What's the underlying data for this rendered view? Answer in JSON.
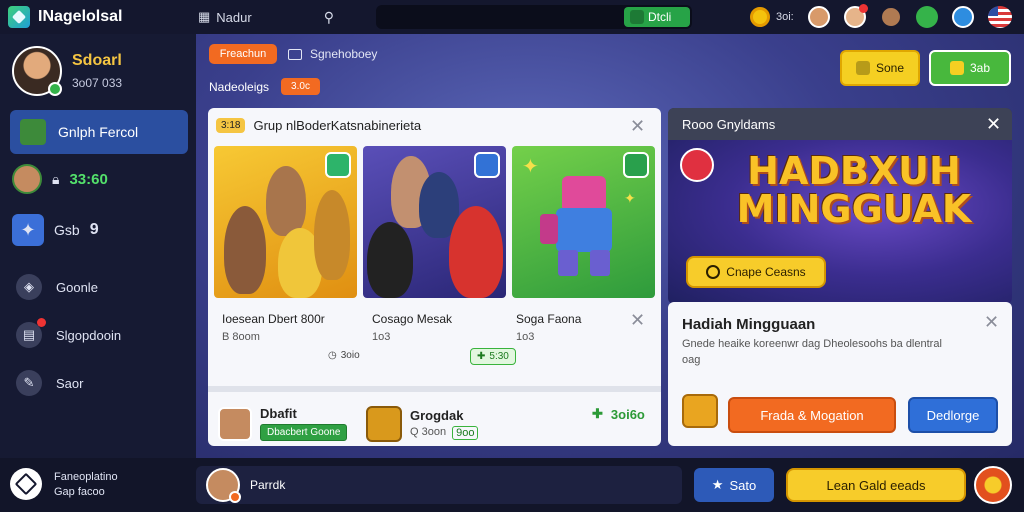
{
  "topbar": {
    "app_title": "INagelolsal",
    "search_label": "Nadur",
    "progress_label": "Dtcli",
    "coins": "3oi:"
  },
  "sidebar": {
    "profile_name": "Sdoarl",
    "profile_id": "3o07 033",
    "active_item": "Gnlph Fercol",
    "stat_value": "33:60",
    "level_label": "Gsb",
    "level_value": "9",
    "nav": [
      {
        "label": "Goonle",
        "icon": "gamepad-icon"
      },
      {
        "label": "Slgopdooin",
        "icon": "store-icon"
      },
      {
        "label": "Saor",
        "icon": "settings-icon"
      }
    ]
  },
  "main": {
    "orange_chip": "Freachun",
    "sub_chip": "Sgnehoboey",
    "section_label": "Nadeoleigs",
    "section_price": "3.0c",
    "yellow_btn": "Sone",
    "green_btn": "3ab"
  },
  "group_card": {
    "tag": "3:18",
    "title": "Grup nlBoderKatsnabinerieta",
    "tiles": [
      {
        "title": "Ioesean Dbert 800r",
        "sub": "B 8oom",
        "pill": "3oio"
      },
      {
        "title": "Cosago Mesak",
        "sub": "1o3",
        "pill": "5:30"
      },
      {
        "title": "Soga Faona",
        "sub": "1o3",
        "pill": ""
      }
    ],
    "bottom": [
      {
        "name": "Dbafit",
        "pill": "Dbacbert Goone"
      },
      {
        "name": "Grogdak",
        "sub": "Q 3oon",
        "pill": "9oo"
      }
    ],
    "amount": "3oi6o"
  },
  "banner": {
    "header": "Rooo Gnyldams",
    "title_line1": "HADBXUH",
    "title_line2": "MINGGUAK",
    "button": "Cnape Ceasns"
  },
  "reward": {
    "title": "Hadiah Mingguaan",
    "desc": "Gnede heaike koreenwr dag Dheolesoohs ba dlentral oag",
    "btn_orange": "Frada & Mogation",
    "btn_blue": "Dedlorge"
  },
  "bottombar": {
    "left_line1": "Faneoplatino",
    "left_line2": "Gap facoo",
    "chat_name": "Parrdk",
    "blue_btn": "Sato",
    "yellow_btn": "Lean Gald eeads"
  },
  "colors": {
    "accent_orange": "#f26a21",
    "accent_yellow": "#f7cc2a",
    "accent_green": "#48b83d",
    "accent_blue": "#2f6fd8",
    "bg_dark": "#161a33"
  }
}
